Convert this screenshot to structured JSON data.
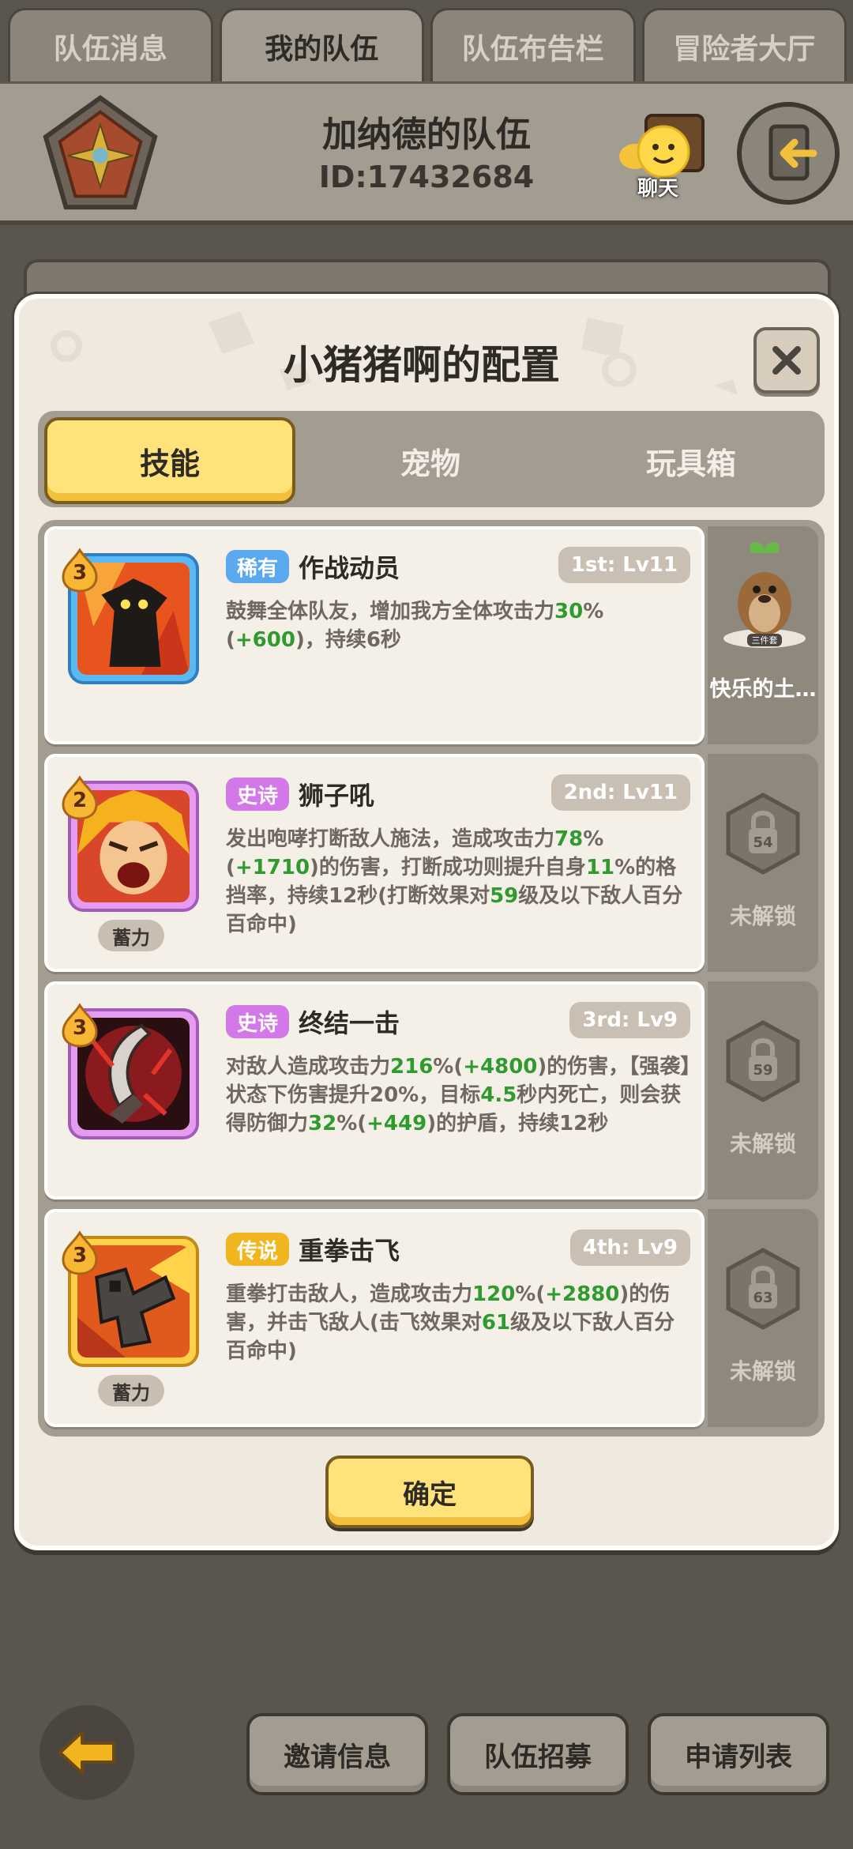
{
  "top_tabs": [
    {
      "label": "队伍消息",
      "active": false
    },
    {
      "label": "我的队伍",
      "active": true
    },
    {
      "label": "队伍布告栏",
      "active": false
    },
    {
      "label": "冒险者大厅",
      "active": false
    }
  ],
  "header": {
    "team_name": "加纳德的队伍",
    "team_id": "ID:17432684",
    "chat_label": "聊天"
  },
  "modal": {
    "title": "小猪猪啊的配置",
    "tabs": [
      {
        "label": "技能",
        "active": true
      },
      {
        "label": "宠物",
        "active": false
      },
      {
        "label": "玩具箱",
        "active": false
      }
    ],
    "skills": [
      {
        "level_badge": "3",
        "rarity": "稀有",
        "name": "作战动员",
        "slot": "1st: Lv11",
        "desc_parts": [
          "鼓舞全体队友，增加我方全体攻击力",
          "30",
          "%(",
          "+600",
          ")，持续6秒"
        ],
        "charge": ""
      },
      {
        "level_badge": "2",
        "rarity": "史诗",
        "name": "狮子吼",
        "slot": "2nd: Lv11",
        "desc_parts": [
          "发出咆哮打断敌人施法，造成攻击力",
          "78",
          "%(",
          "+1710",
          ")的伤害，打断成功则提升自身",
          "11",
          "%的格挡率，持续12秒(打断效果对",
          "59",
          "级及以下敌人百分百命中)"
        ],
        "charge": "蓄力"
      },
      {
        "level_badge": "3",
        "rarity": "史诗",
        "name": "终结一击",
        "slot": "3rd: Lv9",
        "desc_parts": [
          "对敌人造成攻击力",
          "216",
          "%(",
          "+4800",
          ")的伤害，【强袭】状态下伤害提升20%，目标",
          "4.5",
          "秒内死亡，则会获得防御力",
          "32",
          "%(",
          "+449",
          ")的护盾，持续12秒"
        ],
        "charge": ""
      },
      {
        "level_badge": "3",
        "rarity": "传说",
        "name": "重拳击飞",
        "slot": "4th: Lv9",
        "desc_parts": [
          "重拳打击敌人，造成攻击力",
          "120",
          "%(",
          "+2880",
          ")的伤害，并击飞敌人(击飞效果对",
          "61",
          "级及以下敌人百分百命中)"
        ],
        "charge": "蓄力"
      }
    ],
    "side": {
      "pet_label": "快乐的土…",
      "pet_set_tag": "三件套",
      "locks": [
        {
          "level": "54",
          "label": "未解锁"
        },
        {
          "level": "59",
          "label": "未解锁"
        },
        {
          "level": "63",
          "label": "未解锁"
        }
      ]
    },
    "confirm_label": "确定"
  },
  "bottom_buttons": [
    "邀请信息",
    "队伍招募",
    "申请列表"
  ],
  "colors": {
    "background": "#5a554d",
    "panel": "#a39c91",
    "card": "#f5f0e7",
    "accent_yellow": "#ffe27a",
    "green_value": "#2f9b2f",
    "rare_blue": "#5aa8ee",
    "epic_purple": "#d278e8",
    "legend_gold": "#f1b51f"
  }
}
